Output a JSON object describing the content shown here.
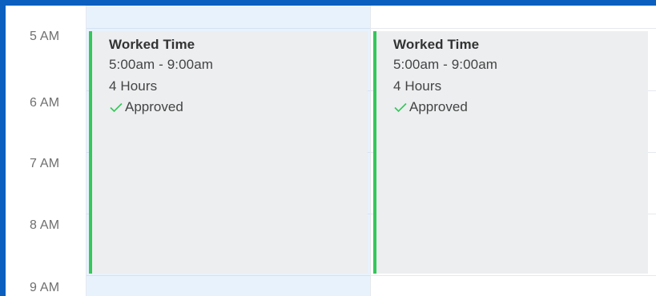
{
  "times": [
    "5 AM",
    "6 AM",
    "7 AM",
    "8 AM",
    "9 AM"
  ],
  "events": [
    {
      "title": "Worked Time",
      "range": "5:00am - 9:00am",
      "duration": "4 Hours",
      "status": "Approved",
      "status_icon": "check-icon",
      "accent_color": "#34c759"
    },
    {
      "title": "Worked Time",
      "range": "5:00am - 9:00am",
      "duration": "4 Hours",
      "status": "Approved",
      "status_icon": "check-icon",
      "accent_color": "#34c759"
    }
  ],
  "colors": {
    "frame": "#0a5fbf",
    "today_column": "#e8f2fd",
    "event_background": "#eceef0"
  }
}
